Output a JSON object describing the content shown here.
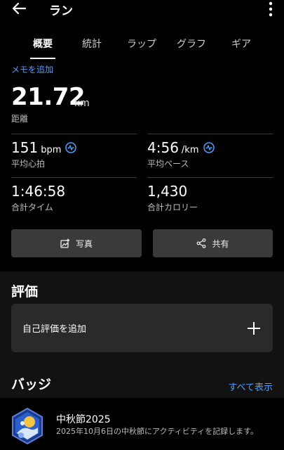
{
  "header": {
    "title": "ラン"
  },
  "tabs": [
    {
      "label": "概要",
      "active": true
    },
    {
      "label": "統計",
      "active": false
    },
    {
      "label": "ラップ",
      "active": false
    },
    {
      "label": "グラフ",
      "active": false
    },
    {
      "label": "ギア",
      "active": false
    }
  ],
  "memo_link": "メモを追加",
  "distance": {
    "value": "21.72",
    "unit": "km",
    "label": "距離"
  },
  "stats": {
    "heart_rate": {
      "value": "151",
      "unit": "bpm",
      "label": "平均心拍"
    },
    "pace": {
      "value": "4:56",
      "unit": "/km",
      "label": "平均ペース"
    },
    "time": {
      "value": "1:46:58",
      "label": "合計タイム"
    },
    "calories": {
      "value": "1,430",
      "label": "合計カロリー"
    }
  },
  "buttons": {
    "photo": "写真",
    "share": "共有"
  },
  "rating": {
    "title": "評価",
    "add_label": "自己評価を追加"
  },
  "badges": {
    "title": "バッジ",
    "see_all": "すべて表示",
    "items": [
      {
        "name": "中秋節2025",
        "description": "2025年10月6日の中秋節にアクティビティを記録します。"
      }
    ]
  },
  "colors": {
    "accent": "#4a9fff",
    "background": "#000000",
    "card": "#2a2a2a",
    "button": "#3a3a3a"
  }
}
